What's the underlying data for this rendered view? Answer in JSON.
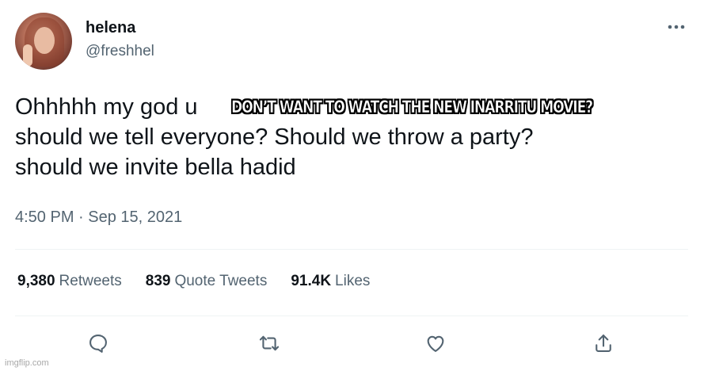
{
  "author": {
    "display_name": "helena",
    "handle": "@freshhel"
  },
  "tweet": {
    "text": "Ohhhhh my god u \nshould we tell everyone? Should we throw a party?\nshould we invite bella hadid",
    "meme_caption": "DON’T WANT TO WATCH THE NEW INARRITU MOVIE?",
    "timestamp": "4:50 PM · Sep 15, 2021"
  },
  "stats": [
    {
      "count": "9,380",
      "label": "Retweets"
    },
    {
      "count": "839",
      "label": "Quote Tweets"
    },
    {
      "count": "91.4K",
      "label": "Likes"
    }
  ],
  "actions": {
    "reply_icon": "reply-icon",
    "retweet_icon": "retweet-icon",
    "like_icon": "heart-icon",
    "share_icon": "share-icon"
  },
  "watermark": "imgflip.com",
  "colors": {
    "text": "#0f1419",
    "secondary": "#536471",
    "divider": "#eff3f4",
    "icon": "#536471"
  }
}
